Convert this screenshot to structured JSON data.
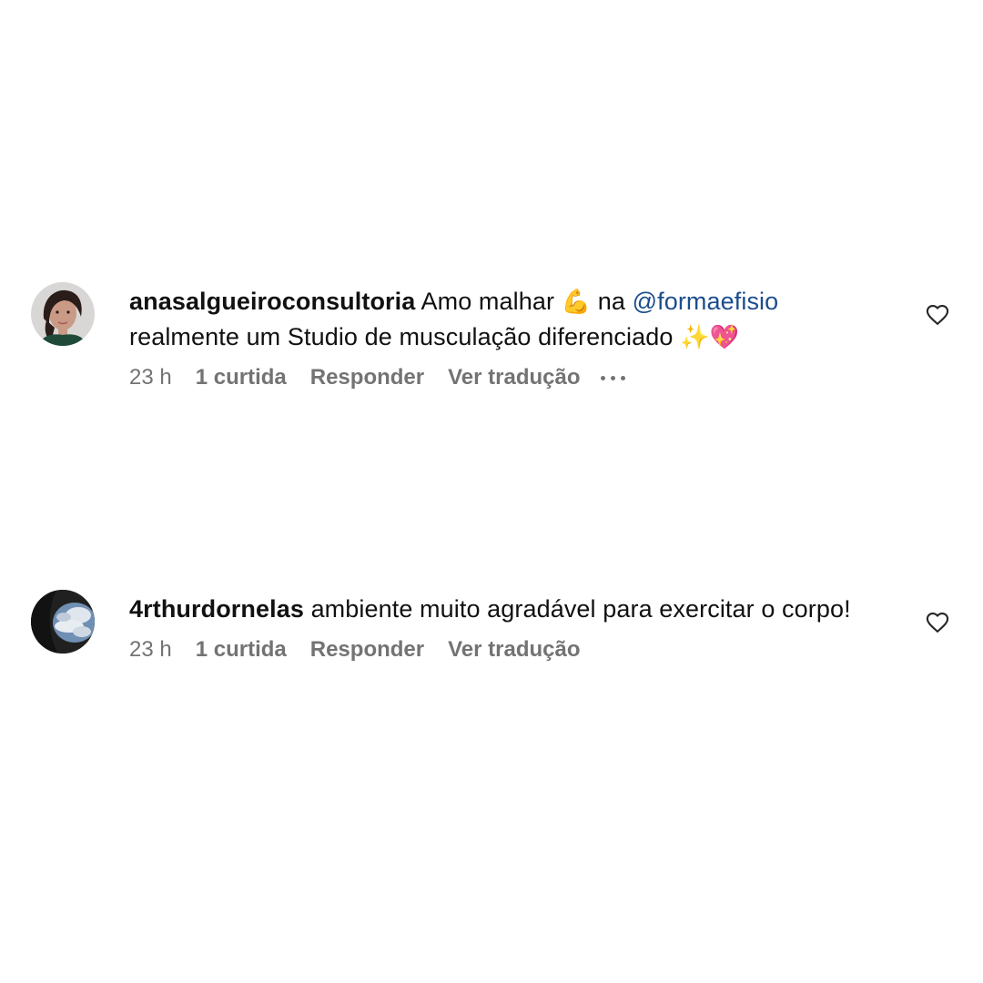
{
  "comments": [
    {
      "username": "anasalgueiroconsultoria",
      "text_before": "Amo malhar",
      "emoji_1": "💪",
      "text_middle": "na",
      "mention": "@formaefisio",
      "text_after": "realmente um Studio de musculação diferenciado",
      "emoji_2": "✨💖",
      "avatar_icon": "profile-photo-woman",
      "time": "23 h",
      "likes": "1 curtida",
      "reply_label": "Responder",
      "translate_label": "Ver tradução",
      "more_icon": "more-horizontal-icon",
      "like_icon": "heart-outline-icon"
    },
    {
      "username": "4rthurdornelas",
      "text": "ambiente muito agradável para exercitar o corpo!",
      "avatar_icon": "profile-photo-sky-clouds",
      "time": "23 h",
      "likes": "1 curtida",
      "reply_label": "Responder",
      "translate_label": "Ver tradução",
      "like_icon": "heart-outline-icon"
    }
  ],
  "colors": {
    "text": "#111111",
    "secondary_text": "#737373",
    "mention": "#1c4d8c",
    "background": "#ffffff"
  }
}
